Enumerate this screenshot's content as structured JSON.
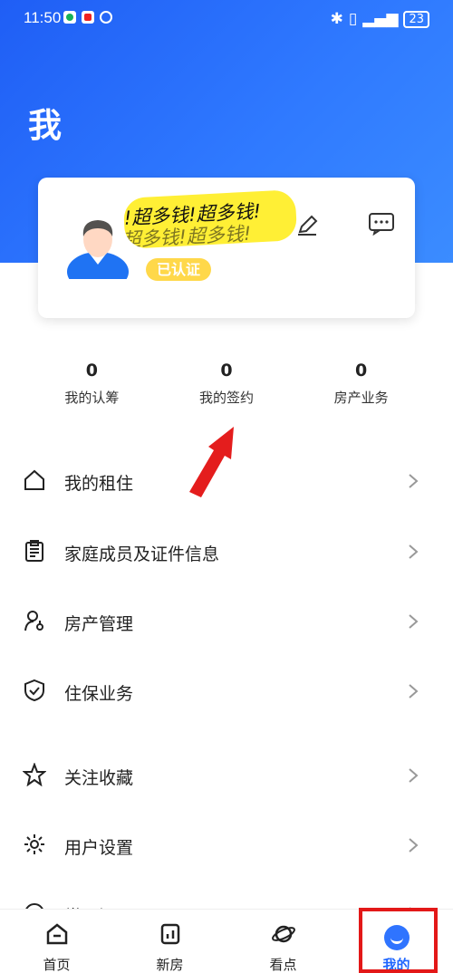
{
  "status": {
    "time": "11:50",
    "battery": "23"
  },
  "page": {
    "title": "我"
  },
  "profile": {
    "username": "!超多钱!超多钱!",
    "verified": "已认证"
  },
  "stats": [
    {
      "value": "0",
      "label": "我的认筹"
    },
    {
      "value": "0",
      "label": "我的签约"
    },
    {
      "value": "0",
      "label": "房产业务"
    }
  ],
  "menu": [
    {
      "label": "我的租住",
      "icon": "house-icon"
    },
    {
      "label": "家庭成员及证件信息",
      "icon": "clipboard-icon"
    },
    {
      "label": "房产管理",
      "icon": "user-key-icon"
    },
    {
      "label": "住保业务",
      "icon": "shield-icon"
    },
    {
      "label": "关注收藏",
      "icon": "star-icon"
    },
    {
      "label": "用户设置",
      "icon": "gear-icon"
    },
    {
      "label": "常见问题",
      "icon": "info-icon"
    }
  ],
  "tabs": [
    {
      "label": "首页",
      "icon": "home-icon"
    },
    {
      "label": "新房",
      "icon": "building-icon"
    },
    {
      "label": "看点",
      "icon": "planet-icon"
    },
    {
      "label": "我的",
      "icon": "smile-icon"
    }
  ],
  "colors": {
    "primary": "#1f66ff",
    "badge": "#ffd84a",
    "annotation": "#e31818"
  }
}
